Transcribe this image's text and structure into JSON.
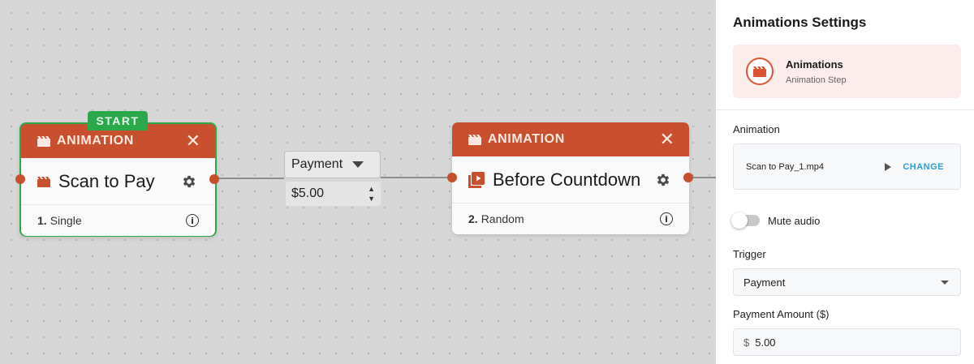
{
  "canvas": {
    "start_badge": "START",
    "nodes": [
      {
        "type_label": "ANIMATION",
        "close_glyph": "✕",
        "name": "Scan to Pay",
        "index": "1.",
        "mode": "Single",
        "info_glyph": "i",
        "icon": "clapperboard-icon",
        "start": true
      },
      {
        "type_label": "ANIMATION",
        "close_glyph": "✕",
        "name": "Before Countdown",
        "index": "2.",
        "mode": "Random",
        "info_glyph": "i",
        "icon": "video-library-icon",
        "start": false
      }
    ],
    "edge": {
      "trigger": "Payment",
      "amount": "$5.00",
      "spin_up": "▲",
      "spin_down": "▼"
    }
  },
  "panel": {
    "title": "Animations Settings",
    "card": {
      "title": "Animations",
      "subtitle": "Animation Step",
      "icon": "clapperboard-icon"
    },
    "animation_label": "Animation",
    "file_name": "Scan to Pay_1.mp4",
    "change_label": "CHANGE",
    "mute_label": "Mute audio",
    "mute_on": false,
    "trigger_label": "Trigger",
    "trigger_value": "Payment",
    "amount_label": "Payment Amount ($)",
    "currency_symbol": "$",
    "amount_value": "5.00"
  },
  "colors": {
    "accent": "#c9502f",
    "start_green": "#2ba84a",
    "link_blue": "#2a9fd0"
  }
}
